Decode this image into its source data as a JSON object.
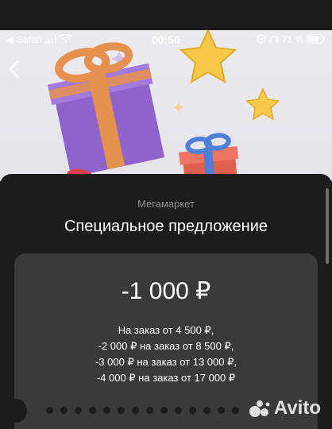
{
  "status_bar": {
    "carrier": "Safari",
    "time": "00:50",
    "battery": "71 %"
  },
  "header": {
    "subtitle": "Мегамаркет",
    "title": "Специальное предложение"
  },
  "offer": {
    "amount": "-1 000 ₽",
    "terms": [
      "На заказ от 4 500 ₽,",
      "-2 000 ₽ на заказ от 8 500 ₽,",
      "-3 000 ₽ на заказ от 13 000 ₽,",
      "-4 000 ₽ на заказ от 17 000 ₽"
    ]
  },
  "watermark": {
    "text": "Avito"
  },
  "icons": [
    "back-arrow-icon",
    "wifi-icon",
    "signal-icon",
    "headphones-icon",
    "lock-rotation-icon",
    "battery-icon",
    "avito-logo-icon"
  ]
}
